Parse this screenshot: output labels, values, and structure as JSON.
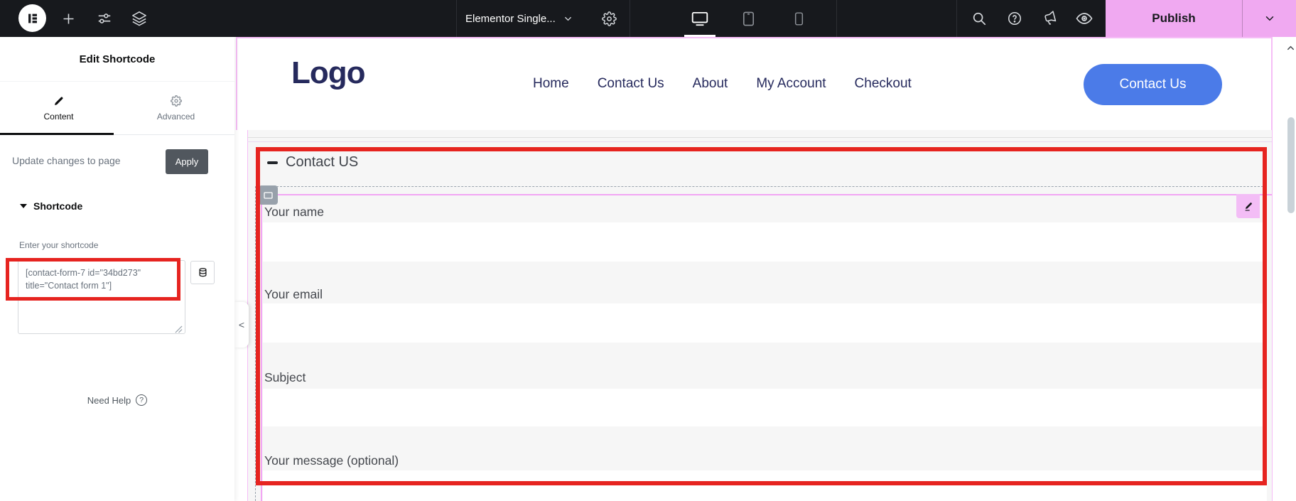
{
  "topbar": {
    "document_title": "Elementor Single...",
    "publish_label": "Publish"
  },
  "panel": {
    "title": "Edit Shortcode",
    "tabs": {
      "content": "Content",
      "advanced": "Advanced"
    },
    "update_changes_label": "Update changes to page",
    "apply_label": "Apply",
    "section_title": "Shortcode",
    "shortcode_field_label": "Enter your shortcode",
    "shortcode_value": "[contact-form-7 id=\"34bd273\" title=\"Contact form 1\"]",
    "need_help_label": "Need Help"
  },
  "canvas": {
    "site_logo": "Logo",
    "nav_items": [
      "Home",
      "Contact Us",
      "About",
      "My Account",
      "Checkout"
    ],
    "cta_button_label": "Contact Us",
    "accordion_title": "Contact US",
    "form": {
      "fields": [
        {
          "label": "Your name"
        },
        {
          "label": "Your email"
        },
        {
          "label": "Subject"
        },
        {
          "label": "Your message (optional)"
        }
      ]
    }
  },
  "colors": {
    "topbar_bg": "#17191d",
    "publish_pink": "#f0a9f1",
    "annotation_red": "#e62420",
    "accent_blue": "#4b7be8",
    "brand_navy": "#262a5d",
    "selection_pink": "#f5bdf6",
    "section_gray": "#f6f6f6",
    "apply_gray": "#51575e"
  }
}
